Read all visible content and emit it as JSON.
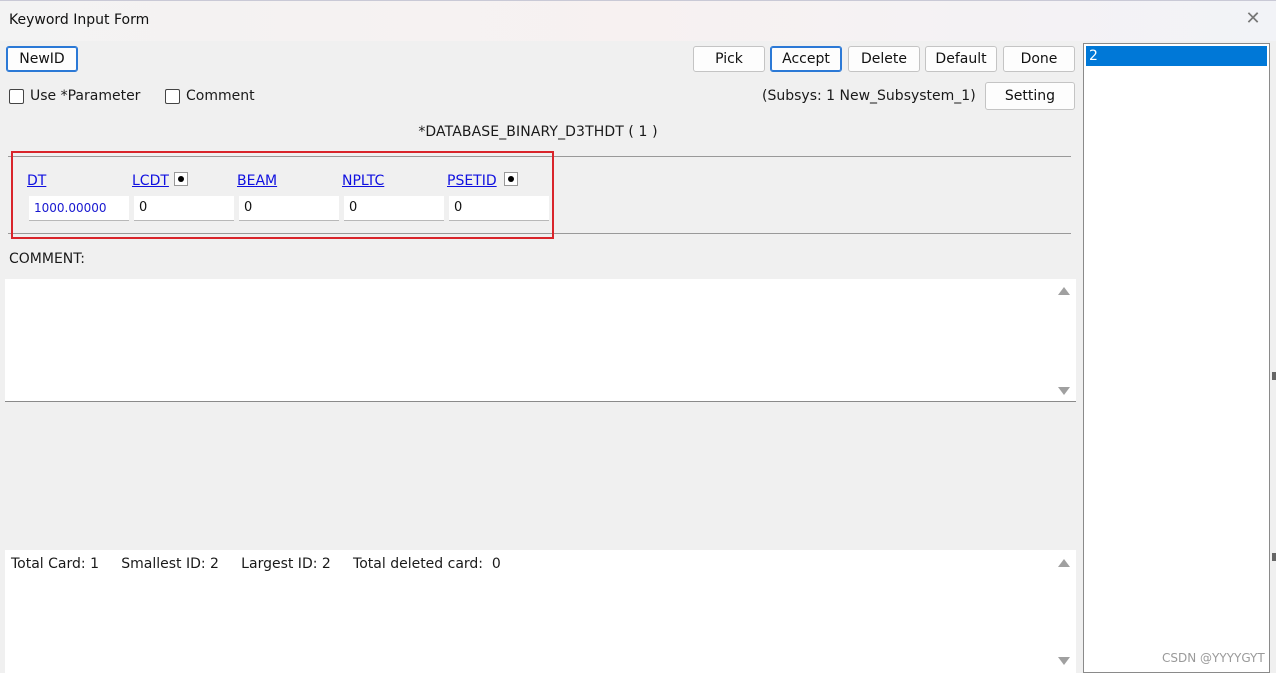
{
  "window": {
    "title": "Keyword Input Form"
  },
  "toolbar": {
    "newid_label": "NewID",
    "pick_label": "Pick",
    "accept_label": "Accept",
    "delete_label": "Delete",
    "default_label": "Default",
    "done_label": "Done",
    "setting_label": "Setting"
  },
  "options": {
    "use_parameter_label": "Use *Parameter",
    "comment_label": "Comment",
    "use_parameter_checked": false,
    "comment_checked": false
  },
  "subsystem": {
    "text": "(Subsys: 1 New_Subsystem_1)"
  },
  "keyword": {
    "title": "*DATABASE_BINARY_D3THDT    ( 1 )"
  },
  "fields": [
    {
      "name": "DT",
      "value": "1000.00000"
    },
    {
      "name": "LCDT",
      "value": "0"
    },
    {
      "name": "BEAM",
      "value": "0"
    },
    {
      "name": "NPLTC",
      "value": "0"
    },
    {
      "name": "PSETID",
      "value": "0"
    }
  ],
  "comment_section": {
    "label": "COMMENT:",
    "text": ""
  },
  "stats": {
    "text": "Total Card: 1     Smallest ID: 2     Largest ID: 2     Total deleted card:  0"
  },
  "id_list": {
    "items": [
      "2"
    ],
    "selected": "2"
  },
  "watermark": "CSDN @YYYYGYT",
  "colors": {
    "highlight_border": "#d9252b",
    "link_blue": "#1010e0",
    "selection_blue": "#0078d7",
    "primary_button_border": "#2b79d6"
  }
}
